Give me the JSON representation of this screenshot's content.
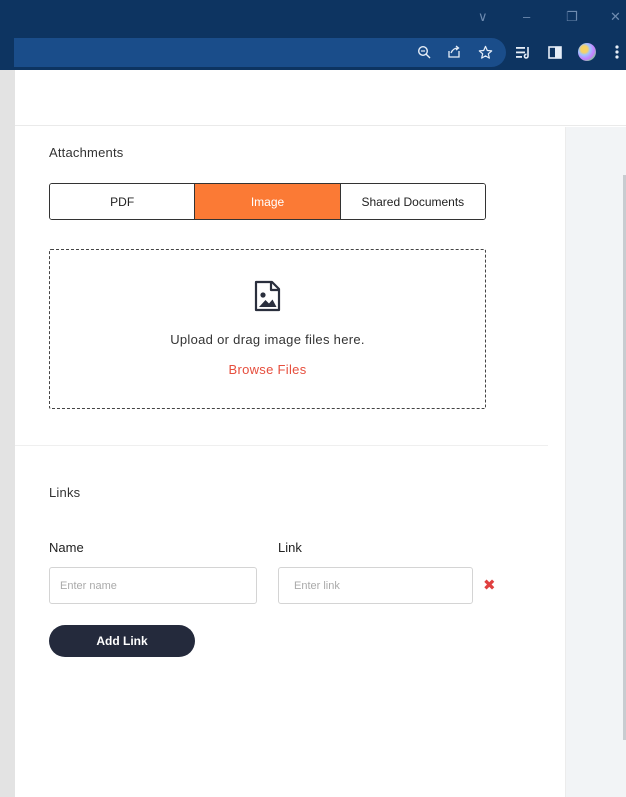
{
  "window_controls": {
    "dropdown": "∨",
    "minimize": "–",
    "restore": "❐",
    "close": "✕"
  },
  "toolbar_icons": [
    "zoom-icon",
    "share-icon",
    "star-icon",
    "reading-list-icon",
    "side-panel-icon",
    "profile-avatar",
    "menu-icon"
  ],
  "attachments": {
    "title": "Attachments",
    "tabs": [
      {
        "label": "PDF",
        "active": false
      },
      {
        "label": "Image",
        "active": true
      },
      {
        "label": "Shared Documents",
        "active": false
      }
    ],
    "dropzone": {
      "text": "Upload or drag image files here.",
      "browse": "Browse Files"
    }
  },
  "links": {
    "title": "Links",
    "name_label": "Name",
    "link_label": "Link",
    "name_placeholder": "Enter name",
    "link_placeholder": "Enter link",
    "add_button": "Add Link"
  },
  "colors": {
    "accent": "#fb7a35",
    "browse": "#e64e3d",
    "button": "#242a3c",
    "chrome": "#0d3461"
  }
}
